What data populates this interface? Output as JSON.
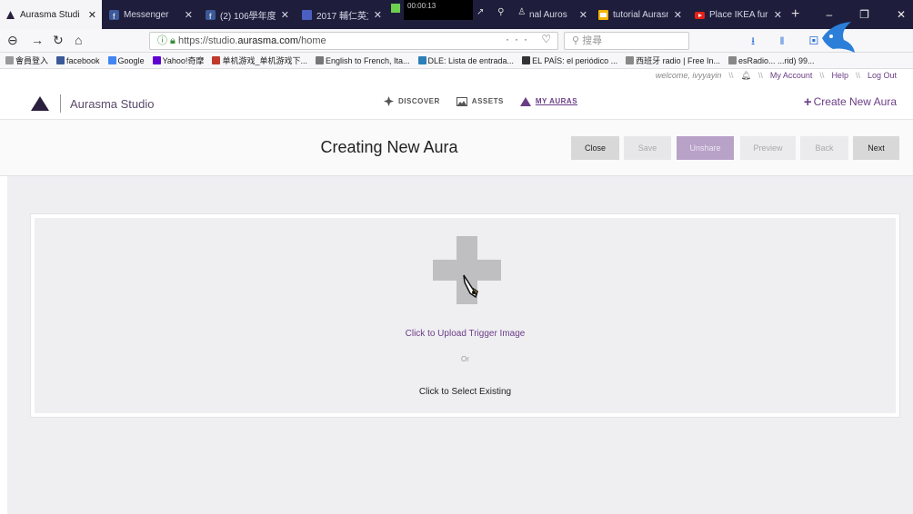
{
  "browser": {
    "tabs": [
      {
        "label": "Aurasma Studi",
        "icon": "aurasma-logo-icon",
        "active": true
      },
      {
        "label": "Messenger",
        "icon": "facebook-icon"
      },
      {
        "label": "(2) 106學年度",
        "icon": "facebook-icon"
      },
      {
        "label": "2017 輔仁英文",
        "icon": "page-icon"
      },
      {
        "label": "nal Auros",
        "icon": "page-icon"
      },
      {
        "label": "tutorial Aurasm",
        "icon": "slides-icon"
      },
      {
        "label": "Place IKEA furr",
        "icon": "youtube-icon"
      }
    ],
    "overlay_timer": "00:00:13",
    "new_tab_label": "+",
    "window_controls": [
      "–",
      "❐",
      "✕"
    ],
    "url_secure": "https://studio.",
    "url_host": "aurasma.com",
    "url_path": "/home",
    "search_placeholder": "搜尋",
    "bookmarks": [
      "會員登入",
      "facebook",
      "Google",
      "Yahoo!奇摩",
      "单机游戏_单机游戏下...",
      "English to French, Ita...",
      "DLE: Lista de entrada...",
      "EL PAÍS: el periódico ...",
      "西班牙 radio | Free In...",
      "esRadio... ...rid) 99..."
    ]
  },
  "app": {
    "userbar": {
      "welcome": "welcome, ivyyayin",
      "sep": "\\\\",
      "my_account": "My Account",
      "help": "Help",
      "logout": "Log Out"
    },
    "logo_text": "Aurasma Studio",
    "nav": {
      "discover": "DISCOVER",
      "assets": "ASSETS",
      "my_auras": "MY AURAS"
    },
    "create_new": "Create New Aura",
    "page_title": "Creating New Aura",
    "buttons": {
      "close": "Close",
      "save": "Save",
      "unshare": "Unshare",
      "preview": "Preview",
      "back": "Back",
      "next": "Next"
    },
    "upload": {
      "upload_link": "Click to Upload Trigger Image",
      "or": "Or",
      "select_link": "Click to Select Existing"
    }
  },
  "colors": {
    "accent": "#6b3d86",
    "tabbar_bg": "#1e1e3c",
    "unshare_bg": "#b8a2c8",
    "page_bg": "#efeff2"
  }
}
